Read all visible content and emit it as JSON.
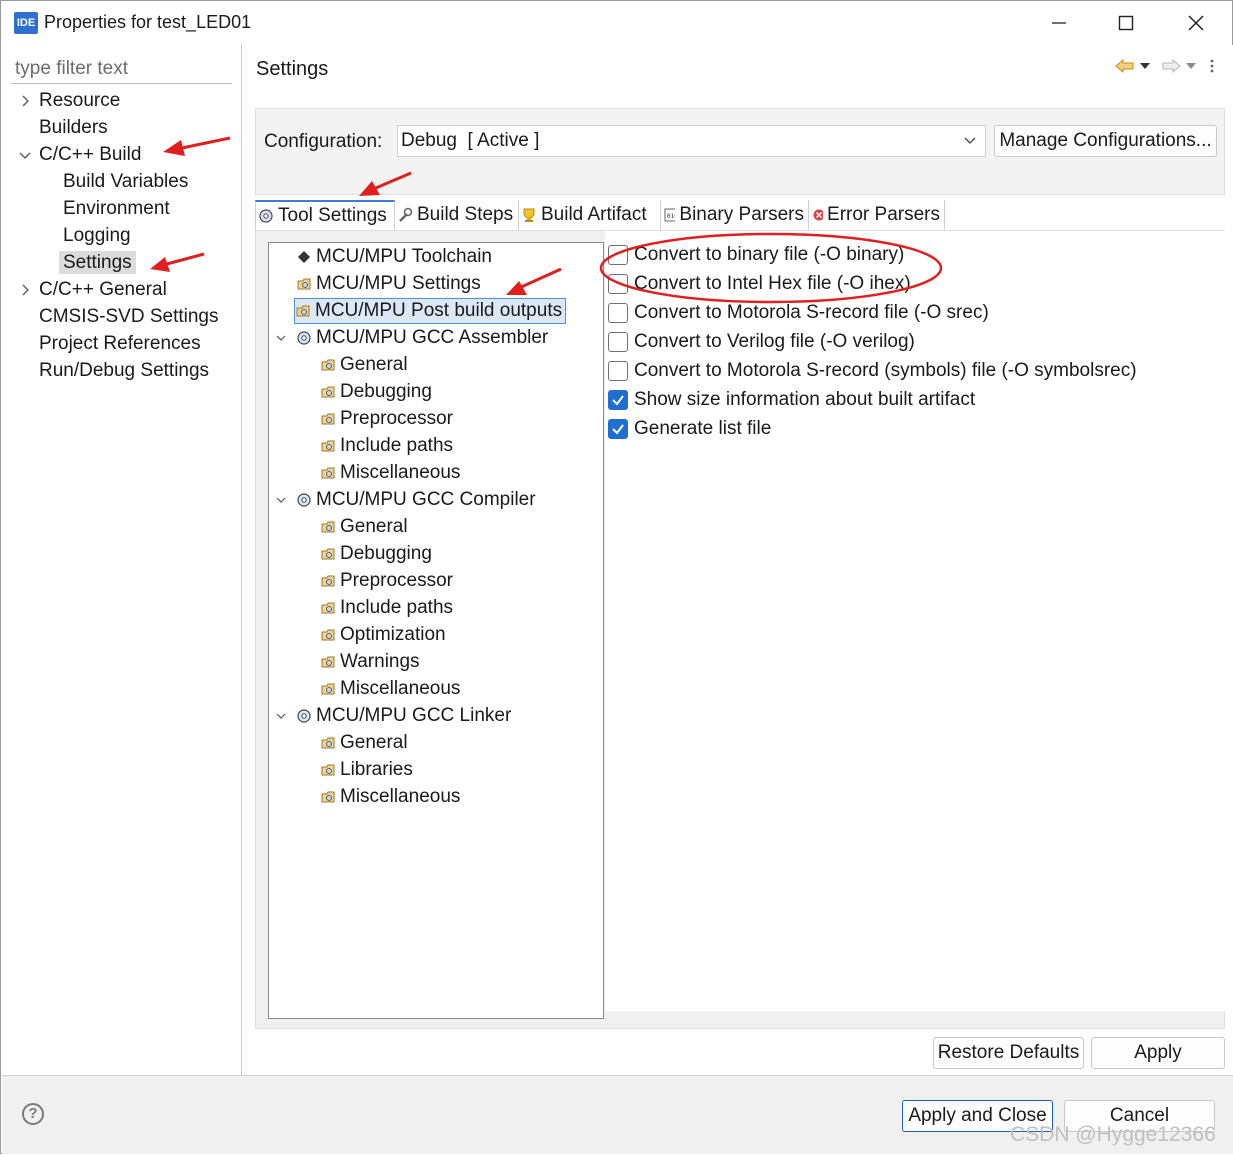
{
  "window": {
    "app_icon": "IDE",
    "title": "Properties for test_LED01"
  },
  "nav": {
    "filter_placeholder": "type filter text",
    "items": [
      {
        "label": "Resource"
      },
      {
        "label": "Builders"
      },
      {
        "label": "C/C++ Build"
      },
      {
        "label": "Build Variables"
      },
      {
        "label": "Environment"
      },
      {
        "label": "Logging"
      },
      {
        "label": "Settings"
      },
      {
        "label": "C/C++ General"
      },
      {
        "label": "CMSIS-SVD Settings"
      },
      {
        "label": "Project References"
      },
      {
        "label": "Run/Debug Settings"
      }
    ],
    "selected": "Settings"
  },
  "settings": {
    "header": "Settings",
    "config_label": "Configuration:",
    "config_value": "Debug  [ Active ]",
    "manage_button": "Manage Configurations..."
  },
  "tabs": [
    {
      "label": "Tool Settings",
      "icon": "gear-icon"
    },
    {
      "label": "Build Steps",
      "icon": "wrench-icon"
    },
    {
      "label": "Build Artifact",
      "icon": "trophy-icon"
    },
    {
      "label": "Binary Parsers",
      "icon": "binary-icon"
    },
    {
      "label": "Error Parsers",
      "icon": "error-icon"
    }
  ],
  "active_tab": "Tool Settings",
  "tool_tree": [
    {
      "label": "MCU/MPU Toolchain"
    },
    {
      "label": "MCU/MPU Settings"
    },
    {
      "label": "MCU/MPU Post build outputs"
    },
    {
      "label": "MCU/MPU GCC Assembler"
    },
    {
      "label": "General"
    },
    {
      "label": "Debugging"
    },
    {
      "label": "Preprocessor"
    },
    {
      "label": "Include paths"
    },
    {
      "label": "Miscellaneous"
    },
    {
      "label": "MCU/MPU GCC Compiler"
    },
    {
      "label": "General"
    },
    {
      "label": "Debugging"
    },
    {
      "label": "Preprocessor"
    },
    {
      "label": "Include paths"
    },
    {
      "label": "Optimization"
    },
    {
      "label": "Warnings"
    },
    {
      "label": "Miscellaneous"
    },
    {
      "label": "MCU/MPU GCC Linker"
    },
    {
      "label": "General"
    },
    {
      "label": "Libraries"
    },
    {
      "label": "Miscellaneous"
    }
  ],
  "tool_tree_selected": "MCU/MPU Post build outputs",
  "options": [
    {
      "label": "Convert to binary file (-O binary)",
      "checked": false
    },
    {
      "label": "Convert to Intel Hex file (-O ihex)",
      "checked": false
    },
    {
      "label": "Convert to Motorola S-record file (-O srec)",
      "checked": false
    },
    {
      "label": "Convert to Verilog file (-O verilog)",
      "checked": false
    },
    {
      "label": "Convert to Motorola S-record (symbols) file (-O symbolsrec)",
      "checked": false
    },
    {
      "label": "Show size information about built artifact",
      "checked": true
    },
    {
      "label": "Generate list file",
      "checked": true
    }
  ],
  "buttons": {
    "restore_defaults": "Restore Defaults",
    "apply": "Apply",
    "apply_and_close": "Apply and Close",
    "cancel": "Cancel"
  },
  "help_glyph": "?",
  "watermark": "CSDN @Hygge12366",
  "colors": {
    "accent": "#1f6fd1",
    "annotation_red": "#e02020",
    "selection_bg": "#dde8f6"
  }
}
